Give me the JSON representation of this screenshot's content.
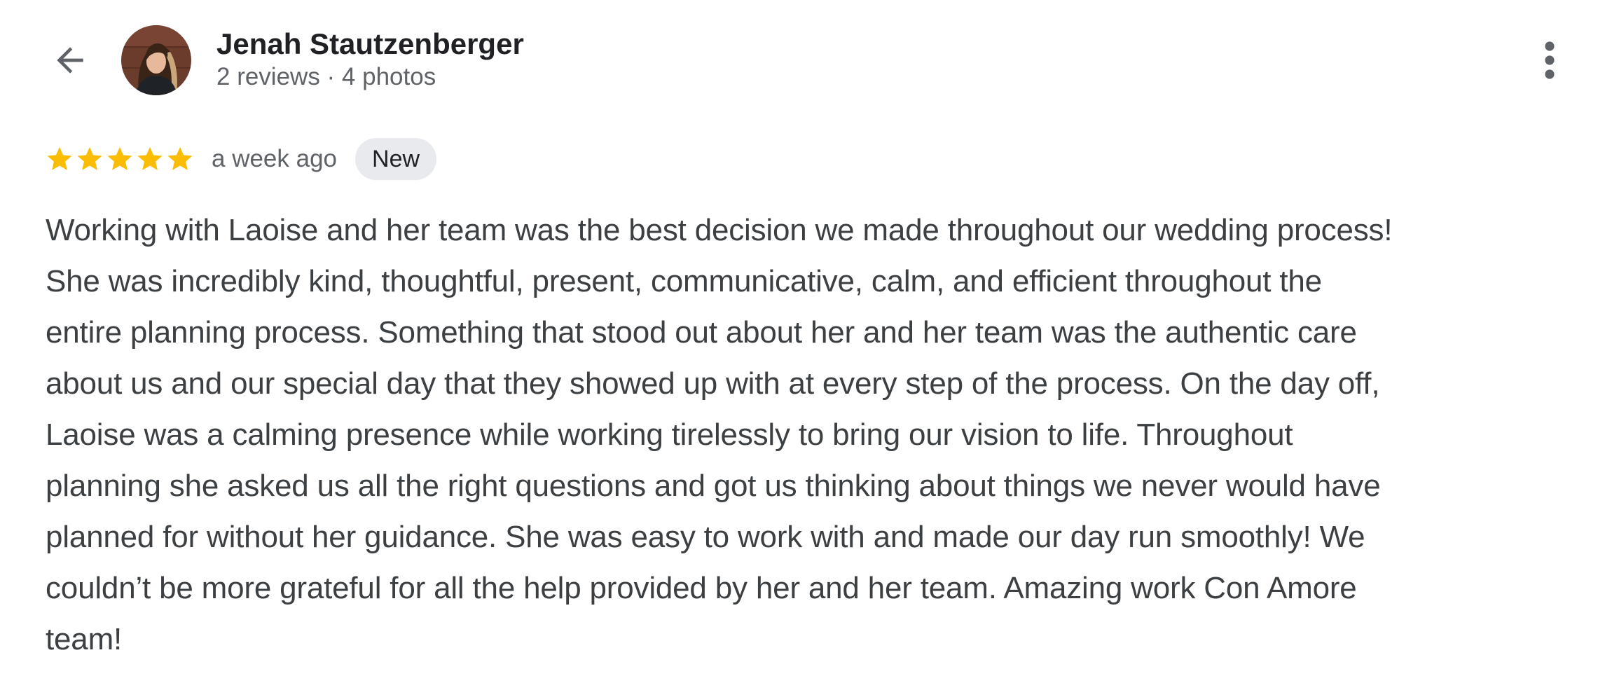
{
  "header": {
    "back_icon": "arrow-back-icon",
    "avatar_icon": "user-avatar",
    "user_name": "Jenah Stautzenberger",
    "user_meta": "2 reviews · 4 photos",
    "more_icon": "more-vert-icon"
  },
  "review": {
    "rating": 5,
    "rating_max": 5,
    "star_color": "#fbbc04",
    "time": "a week ago",
    "badge": "New",
    "text_lines": [
      "Working with Laoise and her team was the best decision we made throughout our wedding process!",
      "She was incredibly kind, thoughtful, present, communicative, calm, and efficient throughout the",
      "entire planning process. Something that stood out about her and her team was the authentic care",
      "about us and our special day that they showed up with at every step of the process. On the day off,",
      "Laoise was a calming presence while working tirelessly to bring our vision to life. Throughout",
      "planning she asked us all the right questions and got us thinking about things we never would have",
      "planned for without her guidance. She was easy to work with and made our day run smoothly! We",
      "couldn’t be more grateful for all the help provided by her and her team. Amazing work Con Amore",
      "team!"
    ]
  },
  "colors": {
    "text_primary": "#202124",
    "text_secondary": "#5f6368",
    "badge_bg": "#e8eaed",
    "icon_gray": "#5f6368"
  }
}
